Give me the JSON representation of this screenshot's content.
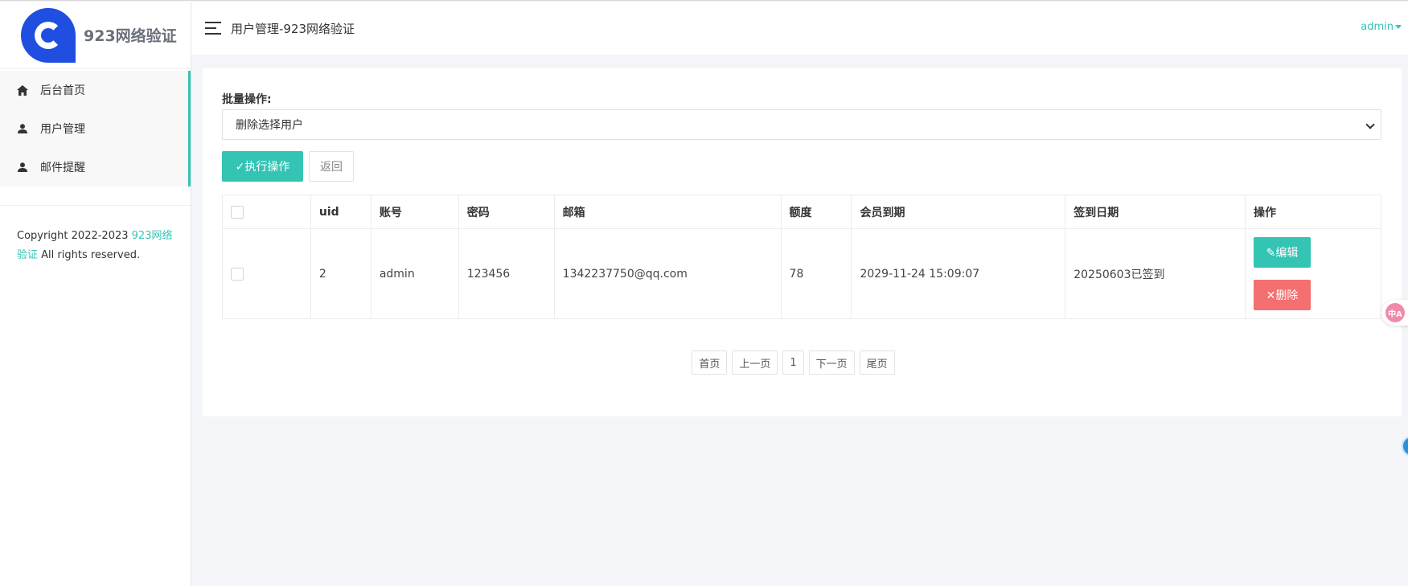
{
  "brand": {
    "name": "923网络验证",
    "logo_letter": "C"
  },
  "sidebar": {
    "items": [
      {
        "label": "后台首页",
        "icon": "home-icon"
      },
      {
        "label": "用户管理",
        "icon": "user-icon"
      },
      {
        "label": "邮件提醒",
        "icon": "user-icon"
      }
    ],
    "copyright_prefix": "Copyright 2022-2023 ",
    "copyright_link": "923网络验证",
    "copyright_suffix": " All rights reserved."
  },
  "header": {
    "title": "用户管理-923网络验证",
    "user": "admin"
  },
  "batch": {
    "label": "批量操作:",
    "selected_option": "删除选择用户",
    "run_label": "✓执行操作",
    "back_label": "返回"
  },
  "table": {
    "columns": [
      "uid",
      "账号",
      "密码",
      "邮箱",
      "额度",
      "会员到期",
      "签到日期",
      "操作"
    ],
    "rows": [
      {
        "uid": "2",
        "account": "admin",
        "password": "123456",
        "email": "1342237750@qq.com",
        "quota": "78",
        "expire": "2029-11-24 15:09:07",
        "signin": "20250603已签到",
        "edit_label": "✎编辑",
        "delete_label": "✕删除"
      }
    ]
  },
  "pagination": {
    "first": "首页",
    "prev": "上一页",
    "current": "1",
    "next": "下一页",
    "last": "尾页"
  },
  "widgets": {
    "translate_glyph": "中A"
  },
  "colors": {
    "accent": "#34c4b4",
    "danger": "#f46f6f",
    "brand_blue": "#1f4ee0"
  }
}
